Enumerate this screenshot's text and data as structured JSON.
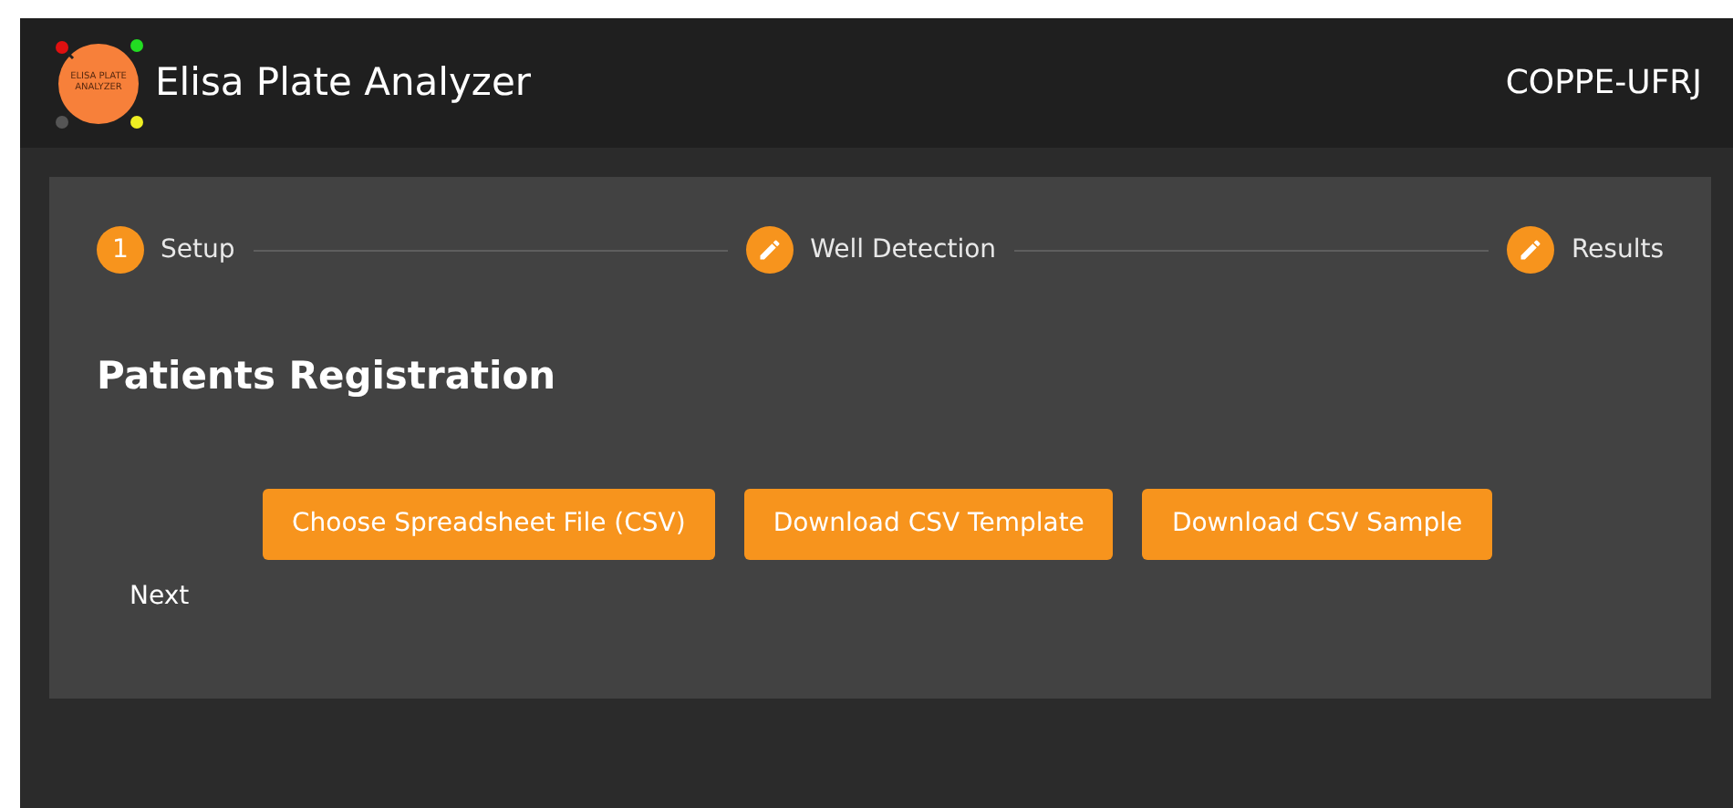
{
  "header": {
    "logo_text": "ELISA PLATE ANALYZER",
    "title": "Elisa Plate Analyzer",
    "org": "COPPE-UFRJ"
  },
  "steps": [
    {
      "kind": "number",
      "number": "1",
      "label": "Setup"
    },
    {
      "kind": "edit",
      "label": "Well Detection"
    },
    {
      "kind": "edit",
      "label": "Results"
    }
  ],
  "heading": "Patients Registration",
  "buttons": [
    "Choose Spreadsheet File (CSV)",
    "Download CSV Template",
    "Download CSV Sample"
  ],
  "next": "Next"
}
